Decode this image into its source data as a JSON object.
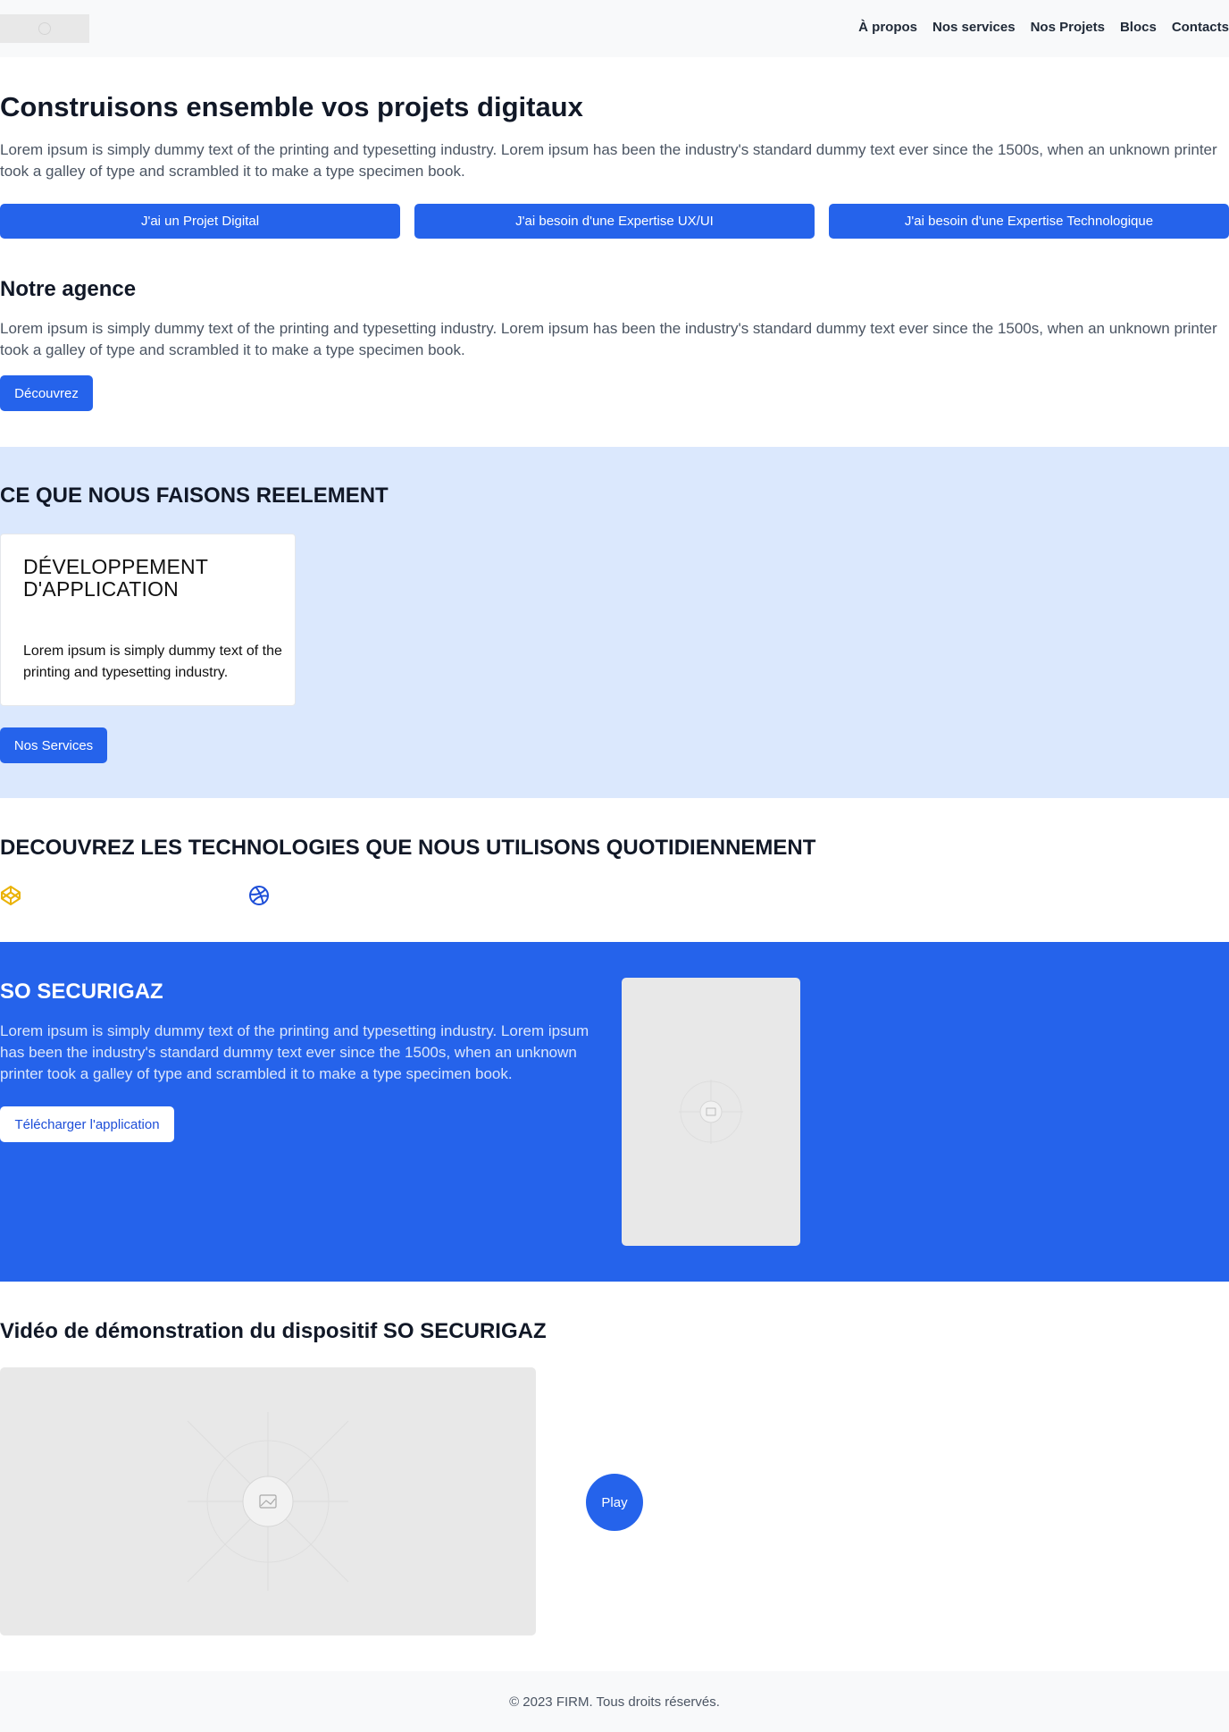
{
  "header": {
    "logo": "logo-placeholder",
    "nav": [
      "À propos",
      "Nos services",
      "Nos Projets",
      "Blocs",
      "Contacts"
    ]
  },
  "hero": {
    "title": "Construisons ensemble vos projets digitaux",
    "text": "Lorem ipsum is simply dummy text of the printing and typesetting industry. Lorem ipsum has been the industry's standard dummy text ever since the 1500s, when an unknown printer took a galley of type and scrambled it to make a type specimen book.",
    "buttons": [
      "J'ai un Projet Digital",
      "J'ai besoin d'une Expertise UX/UI",
      "J'ai besoin d'une Expertise Technologique"
    ]
  },
  "agency": {
    "title": "Notre agence",
    "text": "Lorem ipsum is simply dummy text of the printing and typesetting industry. Lorem ipsum has been the industry's standard dummy text ever since the 1500s, when an unknown printer took a galley of type and scrambled it to make a type specimen book.",
    "button": "Découvrez"
  },
  "services": {
    "title": "CE QUE NOUS FAISONS REELEMENT",
    "card_title": "DÉVELOPPEMENT D'APPLICATION",
    "card_text": "Lorem ipsum is simply dummy text of the printing and typesetting industry.",
    "button": "Nos Services",
    "background": "#dbe8fd"
  },
  "tech": {
    "title": "DECOUVREZ LES TECHNOLOGIES QUE NOUS UTILISONS QUOTIDIENNEMENT",
    "icons": [
      "codepen-icon",
      "dribbble-icon"
    ]
  },
  "product": {
    "title": "SO SECURIGAZ",
    "text": "Lorem ipsum is simply dummy text of the printing and typesetting industry. Lorem ipsum has been the industry's standard dummy text ever since the 1500s, when an unknown printer took a galley of type and scrambled it to make a type specimen book.",
    "button": "Télécharger l'application",
    "background": "#2563eb"
  },
  "video": {
    "title": "Vidéo de démonstration du dispositif SO SECURIGAZ",
    "play": "Play"
  },
  "footer": {
    "text": "© 2023 FIRM. Tous droits réservés."
  },
  "colors": {
    "accent": "#2563eb",
    "light_bg": "#f8f9fa"
  }
}
